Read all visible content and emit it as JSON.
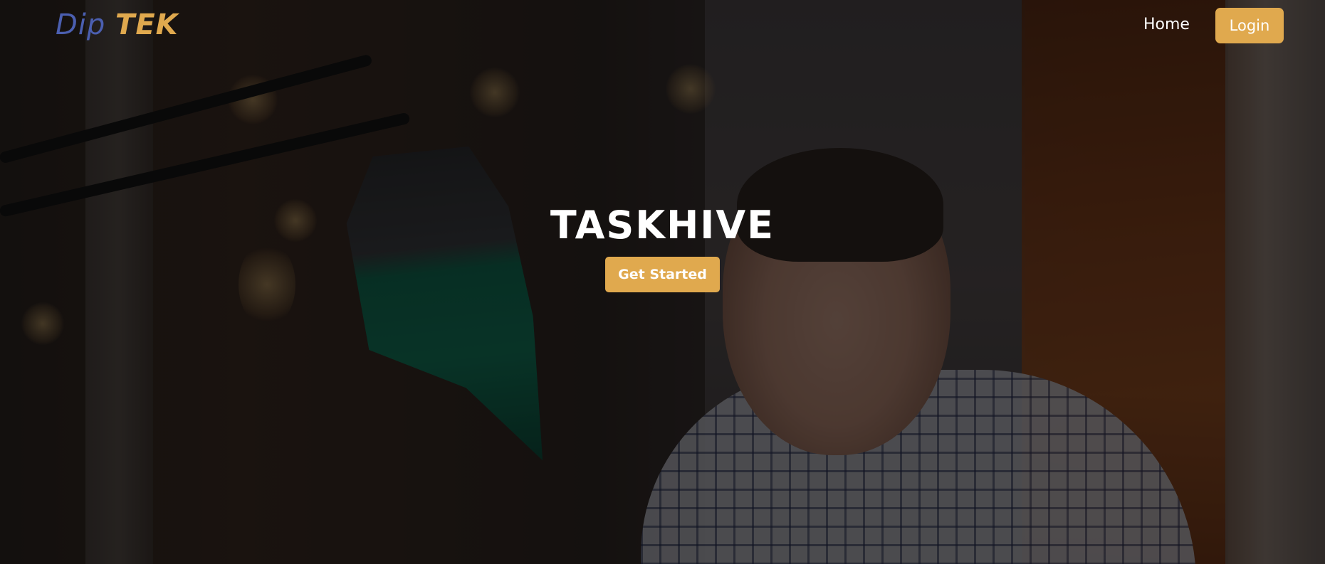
{
  "navbar": {
    "brand_part1": "Dip",
    "brand_part2": "TEK",
    "home_label": "Home",
    "login_label": "Login"
  },
  "hero": {
    "title": "TASKHIVE",
    "cta_label": "Get Started"
  },
  "colors": {
    "accent": "#e0a94e",
    "brand_blue": "#4b5fb0",
    "text": "#ffffff"
  }
}
